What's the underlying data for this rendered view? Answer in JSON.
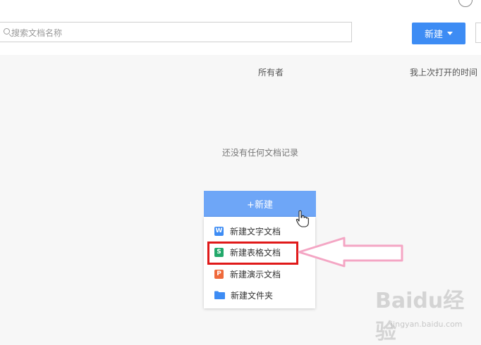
{
  "search": {
    "placeholder": "搜索文档名称"
  },
  "toolbar": {
    "new_label": "新建"
  },
  "columns": {
    "owner": "所有者",
    "last_opened": "我上次打开的时间"
  },
  "empty": {
    "message": "还没有任何文档记录"
  },
  "new_button": {
    "label": "+新建"
  },
  "menu": {
    "items": [
      {
        "label": "新建文字文档",
        "icon": "word-doc-icon",
        "glyph": "W",
        "color": "#3d8cf4"
      },
      {
        "label": "新建表格文档",
        "icon": "spreadsheet-icon",
        "glyph": "S",
        "color": "#22a96b"
      },
      {
        "label": "新建演示文档",
        "icon": "presentation-icon",
        "glyph": "P",
        "color": "#ef6a3c"
      },
      {
        "label": "新建文件夹",
        "icon": "folder-icon",
        "glyph": "",
        "color": "#3d8cf4"
      }
    ]
  },
  "watermark": {
    "brand": "Baidu经验",
    "url": "jingyan.baidu.com"
  },
  "colors": {
    "accent": "#3d8cf4",
    "highlight": "#e01919",
    "arrow": "#f4a6c4"
  }
}
